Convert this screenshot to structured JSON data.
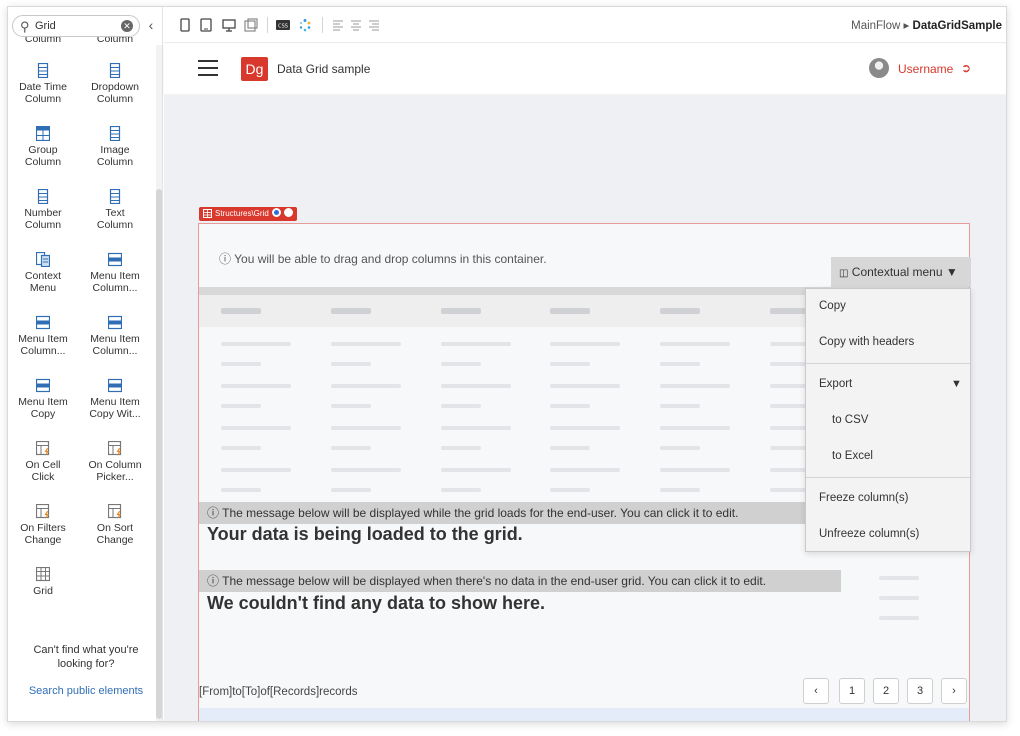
{
  "palette": {
    "search_value": "Grid",
    "items": [
      {
        "label": "Column",
        "icon": "column-icon"
      },
      {
        "label": "Column",
        "icon": "column-icon"
      },
      {
        "label": "Date Time\nColumn",
        "icon": "column-icon"
      },
      {
        "label": "Dropdown\nColumn",
        "icon": "column-icon"
      },
      {
        "label": "Group\nColumn",
        "icon": "group-column-icon"
      },
      {
        "label": "Image\nColumn",
        "icon": "column-icon"
      },
      {
        "label": "Number\nColumn",
        "icon": "column-icon"
      },
      {
        "label": "Text\nColumn",
        "icon": "column-icon"
      },
      {
        "label": "Context\nMenu",
        "icon": "context-menu-icon"
      },
      {
        "label": "Menu Item\nColumn...",
        "icon": "menu-item-icon"
      },
      {
        "label": "Menu Item\nColumn...",
        "icon": "menu-item-icon"
      },
      {
        "label": "Menu Item\nColumn...",
        "icon": "menu-item-icon"
      },
      {
        "label": "Menu Item\nCopy",
        "icon": "menu-item-icon"
      },
      {
        "label": "Menu Item\nCopy Wit...",
        "icon": "menu-item-icon"
      },
      {
        "label": "On Cell\nClick",
        "icon": "event-icon"
      },
      {
        "label": "On Column\nPicker...",
        "icon": "event-icon"
      },
      {
        "label": "On Filters\nChange",
        "icon": "event-icon"
      },
      {
        "label": "On Sort\nChange",
        "icon": "event-icon"
      },
      {
        "label": "Grid",
        "icon": "grid-icon"
      }
    ],
    "cant_find": "Can't find what you're looking for?",
    "search_public": "Search public elements"
  },
  "toolbar": {
    "breadcrumb_parent": "MainFlow",
    "breadcrumb_sep": "▸",
    "breadcrumb_current": "DataGridSample"
  },
  "app": {
    "logo": "Dg",
    "title": "Data Grid sample",
    "username": "Username"
  },
  "grid": {
    "structure_tag": "Structures\\Grid",
    "drag_hint": "ⓘ You will be able to drag and drop columns in this container.",
    "ctx_button": "Contextual menu ▼",
    "menu": {
      "copy": "Copy",
      "copy_headers": "Copy with headers",
      "export": "Export",
      "export_arrow": "▼",
      "to_csv": "to CSV",
      "to_excel": "to Excel",
      "freeze": "Freeze column(s)",
      "unfreeze": "Unfreeze column(s)"
    },
    "loading_hint": "ⓘ The message below will be displayed while the grid loads for the end-user. You can click it to edit.",
    "loading_msg": "Your data is being loaded to the grid.",
    "nodata_hint": "ⓘ The message below will be displayed when there's no data in the end-user grid. You can click it to edit.",
    "nodata_msg": "We couldn't find any data to show here.",
    "record_info": "[From]to[To]of[Records]records",
    "pagination": {
      "prev": "‹",
      "pages": [
        "1",
        "2",
        "3"
      ],
      "next": "›"
    }
  },
  "colors": {
    "accent": "#d9382c",
    "link": "#2f6eb5",
    "icon_blue": "#2f6eb5"
  }
}
